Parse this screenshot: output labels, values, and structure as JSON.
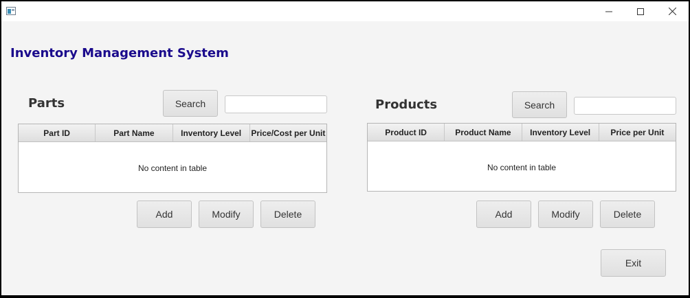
{
  "window": {
    "icon": "app-icon",
    "controls": {
      "minimize_icon": "minimize-icon",
      "maximize_icon": "maximize-icon",
      "close_icon": "close-icon"
    }
  },
  "app_title": "Inventory Management System",
  "parts": {
    "title": "Parts",
    "search_label": "Search",
    "search_value": "",
    "columns": [
      "Part ID",
      "Part Name",
      "Inventory Level",
      "Price/Cost per Unit"
    ],
    "empty_text": "No content in table",
    "add_label": "Add",
    "modify_label": "Modify",
    "delete_label": "Delete"
  },
  "products": {
    "title": "Products",
    "search_label": "Search",
    "search_value": "",
    "columns": [
      "Product ID",
      "Product Name",
      "Inventory Level",
      "Price per Unit"
    ],
    "empty_text": "No content in table",
    "add_label": "Add",
    "modify_label": "Modify",
    "delete_label": "Delete"
  },
  "exit_label": "Exit",
  "colors": {
    "title_color": "#1a0a8c",
    "background": "#f4f4f4"
  }
}
